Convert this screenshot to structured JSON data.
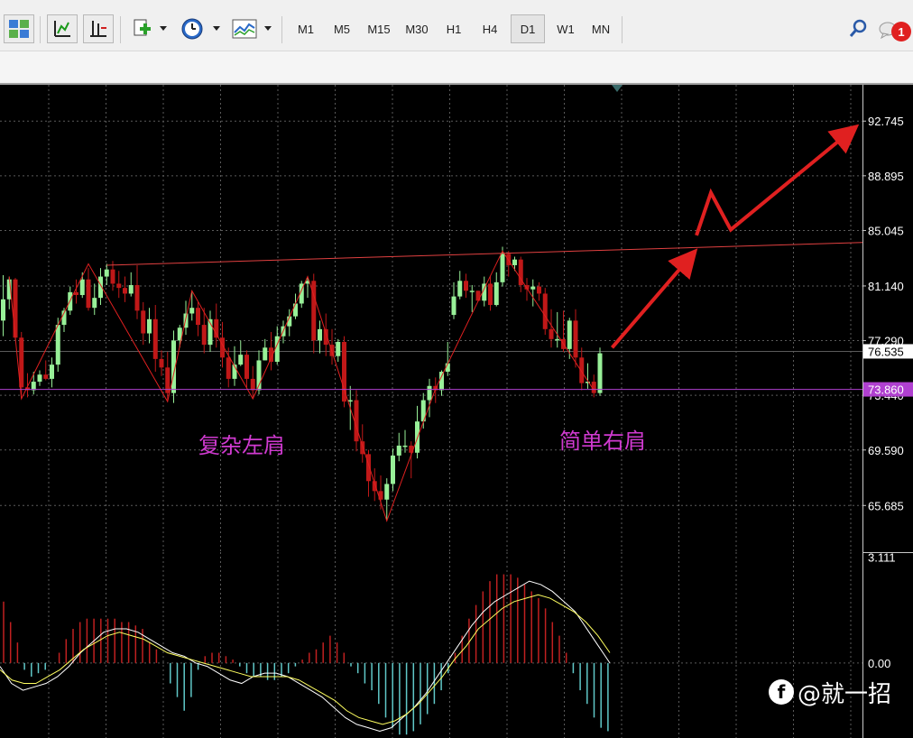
{
  "toolbar": {
    "timeframes": [
      "M1",
      "M5",
      "M15",
      "M30",
      "H1",
      "H4",
      "D1",
      "W1",
      "MN"
    ],
    "active_timeframe": "D1",
    "notification_count": "1",
    "icons": [
      "profiles-icon",
      "chart-line-icon",
      "chart-shift-icon",
      "new-chart-icon",
      "clock-icon",
      "indicators-icon",
      "search-icon",
      "chat-icon"
    ]
  },
  "annotations": {
    "left_shoulder": "复杂左肩",
    "right_shoulder": "简单右肩"
  },
  "watermark": {
    "text": "@就一招",
    "icon": "facebook-circle-icon"
  },
  "colors": {
    "up_candle": "#98f098",
    "down_candle": "#c01818",
    "trend_line": "#e02020",
    "neckline": "#e04040",
    "bid_line": "#b040d0",
    "annotation": "#d03ad0",
    "macd_line": "#ffffff",
    "signal_line": "#ffff60",
    "hist_up": "#c02020",
    "hist_down": "#60c8c8"
  },
  "chart_data": [
    {
      "type": "candlestick",
      "title": "",
      "y_ticks": [
        92.745,
        88.895,
        85.045,
        81.14,
        77.29,
        73.44,
        69.59,
        65.685
      ],
      "y_tick_labels": [
        "92.745",
        "88.895",
        "85.045",
        "81.140",
        "77.290",
        "73.440",
        "69.590",
        "65.685"
      ],
      "ylim": [
        62.4,
        95.3
      ],
      "current_price": {
        "value": 73.86,
        "label": "73.860"
      },
      "reference_price": {
        "value": 76.535,
        "label": "76.535"
      },
      "grid": true,
      "candles": [
        [
          78.7,
          80.2,
          81.9,
          77.6
        ],
        [
          80.2,
          81.6,
          81.8,
          79.5
        ],
        [
          81.6,
          77.5,
          81.7,
          77.3
        ],
        [
          77.5,
          74.0,
          77.9,
          73.2
        ],
        [
          74.0,
          73.8,
          75.0,
          73.3
        ],
        [
          73.8,
          74.4,
          75.1,
          73.5
        ],
        [
          74.4,
          74.9,
          75.2,
          74.1
        ],
        [
          74.9,
          74.6,
          75.9,
          74.5
        ],
        [
          74.6,
          75.6,
          76.1,
          74.0
        ],
        [
          75.6,
          78.4,
          78.9,
          75.1
        ],
        [
          78.4,
          79.4,
          79.6,
          77.9
        ],
        [
          79.4,
          80.7,
          81.1,
          79.1
        ],
        [
          80.7,
          80.5,
          81.6,
          79.9
        ],
        [
          80.5,
          81.6,
          82.1,
          80.3
        ],
        [
          81.6,
          79.6,
          82.4,
          79.4
        ],
        [
          79.6,
          80.3,
          81.3,
          79.1
        ],
        [
          80.3,
          81.8,
          82.4,
          79.8
        ],
        [
          81.8,
          82.3,
          82.7,
          81.2
        ],
        [
          82.3,
          81.3,
          82.9,
          80.8
        ],
        [
          81.3,
          81.0,
          82.2,
          80.3
        ],
        [
          81.0,
          80.6,
          81.8,
          80.0
        ],
        [
          80.6,
          81.2,
          82.1,
          80.4
        ],
        [
          81.2,
          79.4,
          82.6,
          78.8
        ],
        [
          79.4,
          77.8,
          80.0,
          77.0
        ],
        [
          77.8,
          78.8,
          79.6,
          77.1
        ],
        [
          78.8,
          76.0,
          79.8,
          75.1
        ],
        [
          76.0,
          75.4,
          76.6,
          74.8
        ],
        [
          75.4,
          73.6,
          76.5,
          73.0
        ],
        [
          73.6,
          77.3,
          78.0,
          72.9
        ],
        [
          77.3,
          78.2,
          78.4,
          76.8
        ],
        [
          78.2,
          79.2,
          80.1,
          77.7
        ],
        [
          79.2,
          79.6,
          80.8,
          78.7
        ],
        [
          79.6,
          78.4,
          80.0,
          77.6
        ],
        [
          78.4,
          77.0,
          79.6,
          76.4
        ],
        [
          77.0,
          78.8,
          79.4,
          76.5
        ],
        [
          78.8,
          77.5,
          79.9,
          76.8
        ],
        [
          77.5,
          76.1,
          78.6,
          75.4
        ],
        [
          76.1,
          74.6,
          76.8,
          74.0
        ],
        [
          74.6,
          75.6,
          76.9,
          74.1
        ],
        [
          75.6,
          76.3,
          77.3,
          75.5
        ],
        [
          76.3,
          74.6,
          76.6,
          74.0
        ],
        [
          74.6,
          73.8,
          75.5,
          73.2
        ],
        [
          73.8,
          75.9,
          76.6,
          73.5
        ],
        [
          75.9,
          76.8,
          77.4,
          75.9
        ],
        [
          76.8,
          75.8,
          77.9,
          75.2
        ],
        [
          75.8,
          77.6,
          78.3,
          75.6
        ],
        [
          77.6,
          78.3,
          78.7,
          77.1
        ],
        [
          78.3,
          79.0,
          79.5,
          77.6
        ],
        [
          79.0,
          79.9,
          80.6,
          78.8
        ],
        [
          79.9,
          81.3,
          81.5,
          79.6
        ],
        [
          81.3,
          81.5,
          81.8,
          80.3
        ],
        [
          81.5,
          77.3,
          82.0,
          76.4
        ],
        [
          77.3,
          78.1,
          78.7,
          76.4
        ],
        [
          78.1,
          77.0,
          79.2,
          76.2
        ],
        [
          77.0,
          76.2,
          78.1,
          75.6
        ],
        [
          76.2,
          77.2,
          77.4,
          75.8
        ],
        [
          77.2,
          73.0,
          77.6,
          72.6
        ],
        [
          73.0,
          73.1,
          74.1,
          71.0
        ],
        [
          73.1,
          70.2,
          73.8,
          69.5
        ],
        [
          70.2,
          69.3,
          71.4,
          68.7
        ],
        [
          69.3,
          67.4,
          69.6,
          66.3
        ],
        [
          67.4,
          66.7,
          68.3,
          66.0
        ],
        [
          66.7,
          66.1,
          67.8,
          65.4
        ],
        [
          66.1,
          67.2,
          67.6,
          64.6
        ],
        [
          67.2,
          69.2,
          69.7,
          66.7
        ],
        [
          69.2,
          69.9,
          70.8,
          68.8
        ],
        [
          69.9,
          69.9,
          71.0,
          69.4
        ],
        [
          69.9,
          69.4,
          70.2,
          67.6
        ],
        [
          69.4,
          71.6,
          72.7,
          69.0
        ],
        [
          71.6,
          73.1,
          73.6,
          71.1
        ],
        [
          73.1,
          74.1,
          74.6,
          71.9
        ],
        [
          74.1,
          73.8,
          74.7,
          72.9
        ],
        [
          73.8,
          75.1,
          75.2,
          73.4
        ],
        [
          75.1,
          75.7,
          77.2,
          74.8
        ],
        [
          79.1,
          80.4,
          81.4,
          78.8
        ],
        [
          80.4,
          81.5,
          82.2,
          80.2
        ],
        [
          81.5,
          80.8,
          82.0,
          80.3
        ],
        [
          80.8,
          80.8,
          81.2,
          79.3
        ],
        [
          80.8,
          80.1,
          80.7,
          80.8
        ],
        [
          80.1,
          81.3,
          81.8,
          79.7
        ],
        [
          81.3,
          79.8,
          81.8,
          79.4
        ],
        [
          79.8,
          81.4,
          82.1,
          79.7
        ],
        [
          81.4,
          83.4,
          83.9,
          81.1
        ],
        [
          83.4,
          82.6,
          83.6,
          81.8
        ],
        [
          82.6,
          83.0,
          83.2,
          82.2
        ],
        [
          83.0,
          81.2,
          83.2,
          80.7
        ],
        [
          81.2,
          80.9,
          81.7,
          80.1
        ],
        [
          80.9,
          81.1,
          81.6,
          79.7
        ],
        [
          81.1,
          80.6,
          81.4,
          80.1
        ],
        [
          80.6,
          78.1,
          81.0,
          77.7
        ],
        [
          78.1,
          77.4,
          79.5,
          76.8
        ],
        [
          77.4,
          77.4,
          79.3,
          76.8
        ],
        [
          77.4,
          76.7,
          79.4,
          76.5
        ],
        [
          76.7,
          78.7,
          78.9,
          76.0
        ],
        [
          78.7,
          76.1,
          79.5,
          75.4
        ],
        [
          76.1,
          74.3,
          76.8,
          73.8
        ],
        [
          74.3,
          74.4,
          75.7,
          73.9
        ],
        [
          74.4,
          73.6,
          74.9,
          73.3
        ],
        [
          73.6,
          76.4,
          76.8,
          73.4
        ]
      ],
      "zigzag": [
        [
          81.8,
          1
        ],
        [
          73.2,
          3
        ],
        [
          82.7,
          14
        ],
        [
          73.0,
          27
        ],
        [
          80.8,
          31
        ],
        [
          73.2,
          41
        ],
        [
          81.8,
          50
        ],
        [
          64.6,
          63
        ],
        [
          73.9,
          71
        ],
        [
          83.6,
          82
        ],
        [
          73.8,
          97
        ]
      ],
      "neckline": {
        "from": 82.6,
        "to": 84.2
      },
      "projection_arrows": [
        [
          76.8,
          83.4
        ],
        [
          84.7,
          87.7,
          85.1,
          92.2
        ]
      ]
    },
    {
      "type": "macd",
      "y_tick_labels": [
        "3.111",
        "0.00"
      ],
      "ylim": [
        -2.2,
        3.25
      ],
      "histogram": [
        1.8,
        1.2,
        0.6,
        -0.2,
        -0.4,
        -0.3,
        -0.2,
        0.0,
        0.3,
        0.7,
        1.0,
        1.2,
        1.3,
        1.3,
        1.3,
        1.3,
        1.3,
        1.2,
        1.2,
        1.1,
        1.0,
        0.6,
        0.4,
        0.0,
        -0.6,
        -1.0,
        -1.4,
        -1.0,
        -0.2,
        0.2,
        0.3,
        0.3,
        0.2,
        0.1,
        -0.1,
        -0.3,
        -0.4,
        -0.4,
        -0.5,
        -0.5,
        -0.4,
        -0.3,
        -0.1,
        0.1,
        0.3,
        0.4,
        0.6,
        0.8,
        0.6,
        0.3,
        -0.1,
        -0.3,
        -0.6,
        -0.8,
        -1.2,
        -1.6,
        -1.9,
        -2.1,
        -2.1,
        -2.0,
        -1.8,
        -1.5,
        -1.2,
        -0.8,
        -0.3,
        0.3,
        0.8,
        1.3,
        1.7,
        2.1,
        2.4,
        2.6,
        2.6,
        2.6,
        2.5,
        2.3,
        2.1,
        1.9,
        1.6,
        1.2,
        0.8,
        0.3,
        -0.3,
        -0.8,
        -1.2,
        -1.6,
        -1.9,
        -2.0
      ],
      "macd_line": [
        -0.1,
        -0.6,
        -0.8,
        -0.7,
        -0.6,
        -0.4,
        -0.1,
        0.3,
        0.6,
        0.9,
        1.0,
        1.0,
        0.9,
        0.7,
        0.5,
        0.3,
        0.2,
        0.0,
        -0.1,
        -0.3,
        -0.5,
        -0.6,
        -0.4,
        -0.3,
        -0.3,
        -0.4,
        -0.6,
        -0.8,
        -1.0,
        -1.3,
        -1.6,
        -1.8,
        -1.9,
        -2.0,
        -1.9,
        -1.6,
        -1.3,
        -0.9,
        -0.4,
        0.1,
        0.6,
        1.1,
        1.5,
        1.8,
        2.0,
        2.2,
        2.4,
        2.3,
        2.1,
        1.8,
        1.5,
        1.0,
        0.5,
        0.0
      ],
      "signal_line": [
        -0.2,
        -0.5,
        -0.6,
        -0.6,
        -0.4,
        -0.2,
        0.1,
        0.4,
        0.6,
        0.8,
        0.9,
        0.8,
        0.7,
        0.5,
        0.3,
        0.2,
        0.1,
        0.0,
        -0.1,
        -0.2,
        -0.3,
        -0.4,
        -0.4,
        -0.4,
        -0.4,
        -0.5,
        -0.7,
        -0.9,
        -1.1,
        -1.4,
        -1.6,
        -1.7,
        -1.8,
        -1.7,
        -1.5,
        -1.2,
        -0.8,
        -0.4,
        0.1,
        0.5,
        1.0,
        1.3,
        1.6,
        1.8,
        1.9,
        2.0,
        1.9,
        1.7,
        1.5,
        1.2,
        0.8,
        0.3
      ]
    }
  ]
}
